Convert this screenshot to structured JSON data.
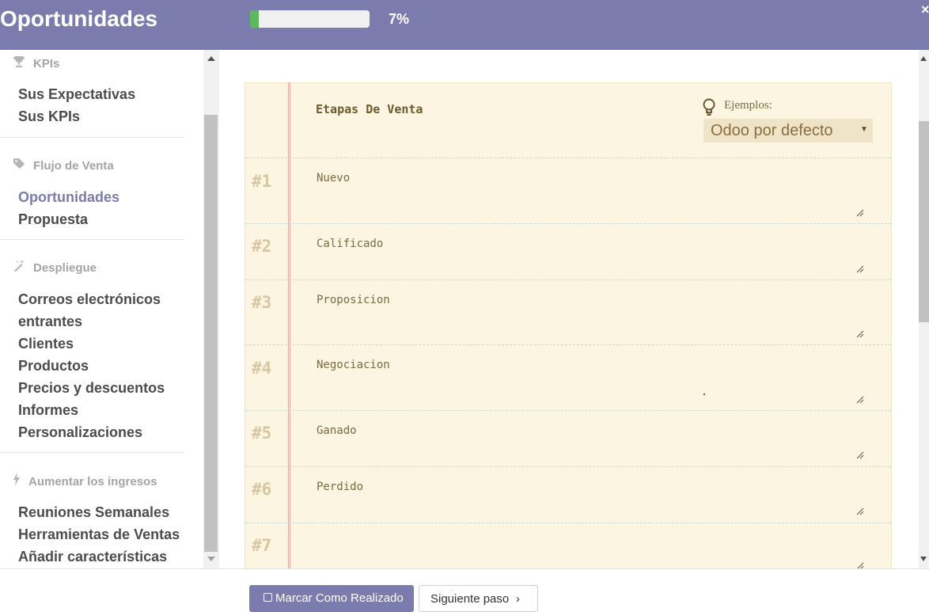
{
  "header": {
    "title": "Oportunidades",
    "progress_percent": 7,
    "progress_label": "7%",
    "close_glyph": "×",
    "accent_color": "#7c7bad",
    "progress_color": "#5cb85c"
  },
  "sidebar": {
    "sections": [
      {
        "heading": "KPIs",
        "icon": "trophy-icon",
        "items": [
          "Sus Expectativas",
          "Sus KPIs"
        ]
      },
      {
        "heading": "Flujo de Venta",
        "icon": "tag-icon",
        "items": [
          "Oportunidades",
          "Propuesta"
        ]
      },
      {
        "heading": "Despliegue",
        "icon": "magic-wand-icon",
        "items": [
          "Correos electrónicos",
          "entrantes",
          "Clientes",
          "Productos",
          "Precios y descuentos",
          "Informes",
          "Personalizaciones"
        ]
      },
      {
        "heading": "Aumentar los ingresos",
        "icon": "bolt-icon",
        "items": [
          "Reuniones Semanales",
          "Herramientas de Ventas",
          "Añadir características"
        ]
      }
    ],
    "active_item": "Oportunidades"
  },
  "main": {
    "sheet_title": "Etapas De Venta",
    "examples_label": "Ejemplos:",
    "examples_select_value": "Odoo por defecto",
    "stages": [
      {
        "num": "#1",
        "text": "Nuevo"
      },
      {
        "num": "#2",
        "text": "Calificado"
      },
      {
        "num": "#3",
        "text": "Proposicion"
      },
      {
        "num": "#4",
        "text": "Negociacion"
      },
      {
        "num": "#5",
        "text": "Ganado"
      },
      {
        "num": "#6",
        "text": "Perdido"
      },
      {
        "num": "#7",
        "text": ""
      }
    ]
  },
  "footer": {
    "mark_done_label": "Marcar Como Realizado",
    "next_step_label": "Siguiente paso",
    "next_chevron": "›"
  }
}
